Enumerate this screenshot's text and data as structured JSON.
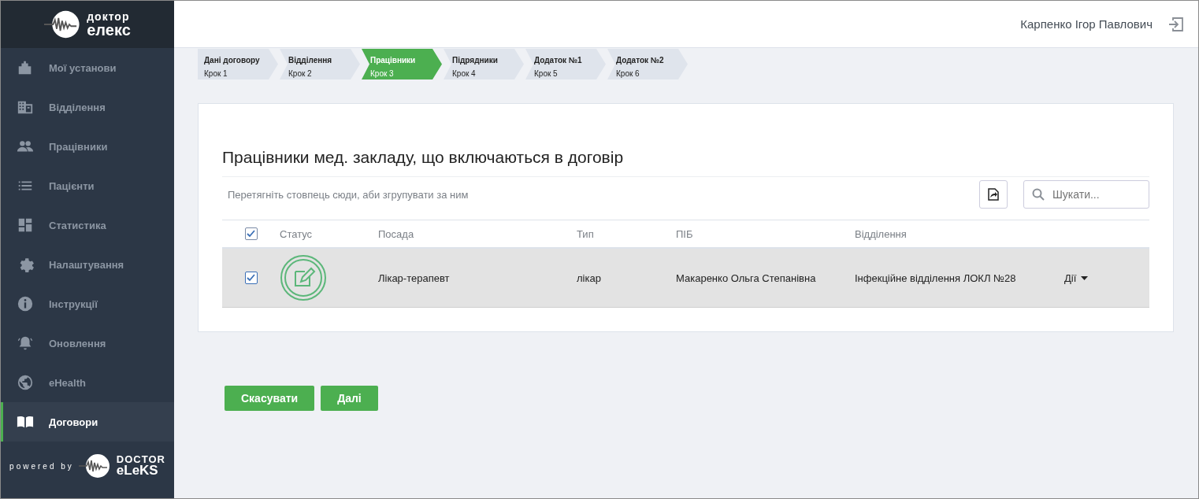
{
  "sidebar": {
    "logo": {
      "line_1": "доктор",
      "line_2": "елекс"
    },
    "items": [
      {
        "label": "Мої установи",
        "selected": false
      },
      {
        "label": "Відділення",
        "selected": false
      },
      {
        "label": "Працівники",
        "selected": false
      },
      {
        "label": "Пацієнти",
        "selected": false
      },
      {
        "label": "Статистика",
        "selected": false
      },
      {
        "label": "Налаштування",
        "selected": false
      },
      {
        "label": "Інструкції",
        "selected": false
      },
      {
        "label": "Оновлення",
        "selected": false
      },
      {
        "label": "eHealth",
        "selected": false
      },
      {
        "label": "Договори",
        "selected": true
      }
    ],
    "footer": {
      "powered_by": "powered by",
      "brand_line_1": "DOCTOR",
      "brand_line_2": "eLeKS"
    }
  },
  "header": {
    "user_name": "Карпенко Ігор Павлович"
  },
  "steps": [
    {
      "label": "Дані договору",
      "step": "Крок 1",
      "selected": false
    },
    {
      "label": "Відділення",
      "step": "Крок 2",
      "selected": false
    },
    {
      "label": "Працівники",
      "step": "Крок 3",
      "selected": true
    },
    {
      "label": "Підрядники",
      "step": "Крок 4",
      "selected": false
    },
    {
      "label": "Додаток №1",
      "step": "Крок 5",
      "selected": false
    },
    {
      "label": "Додаток №2",
      "step": "Крок 6",
      "selected": false
    }
  ],
  "card": {
    "title": "Працівники мед. закладу, що включаються в договір",
    "group_hint": "Перетягніть стовпець сюди, аби згрупувати за ним",
    "search": {
      "placeholder": "Шукати..."
    },
    "table": {
      "select_all_checked": true,
      "columns": [
        "Статус",
        "Посада",
        "Тип",
        "ПІБ",
        "Відділення"
      ],
      "rows": [
        {
          "checked": true,
          "position": "Лікар-терапевт",
          "type": "лікар",
          "name": "Макаренко Ольга Степанівна",
          "department": "Інфекційне відділення ЛОКЛ №28",
          "actions": "Дії"
        }
      ]
    }
  },
  "buttons": [
    "Скасувати",
    "Далі"
  ]
}
